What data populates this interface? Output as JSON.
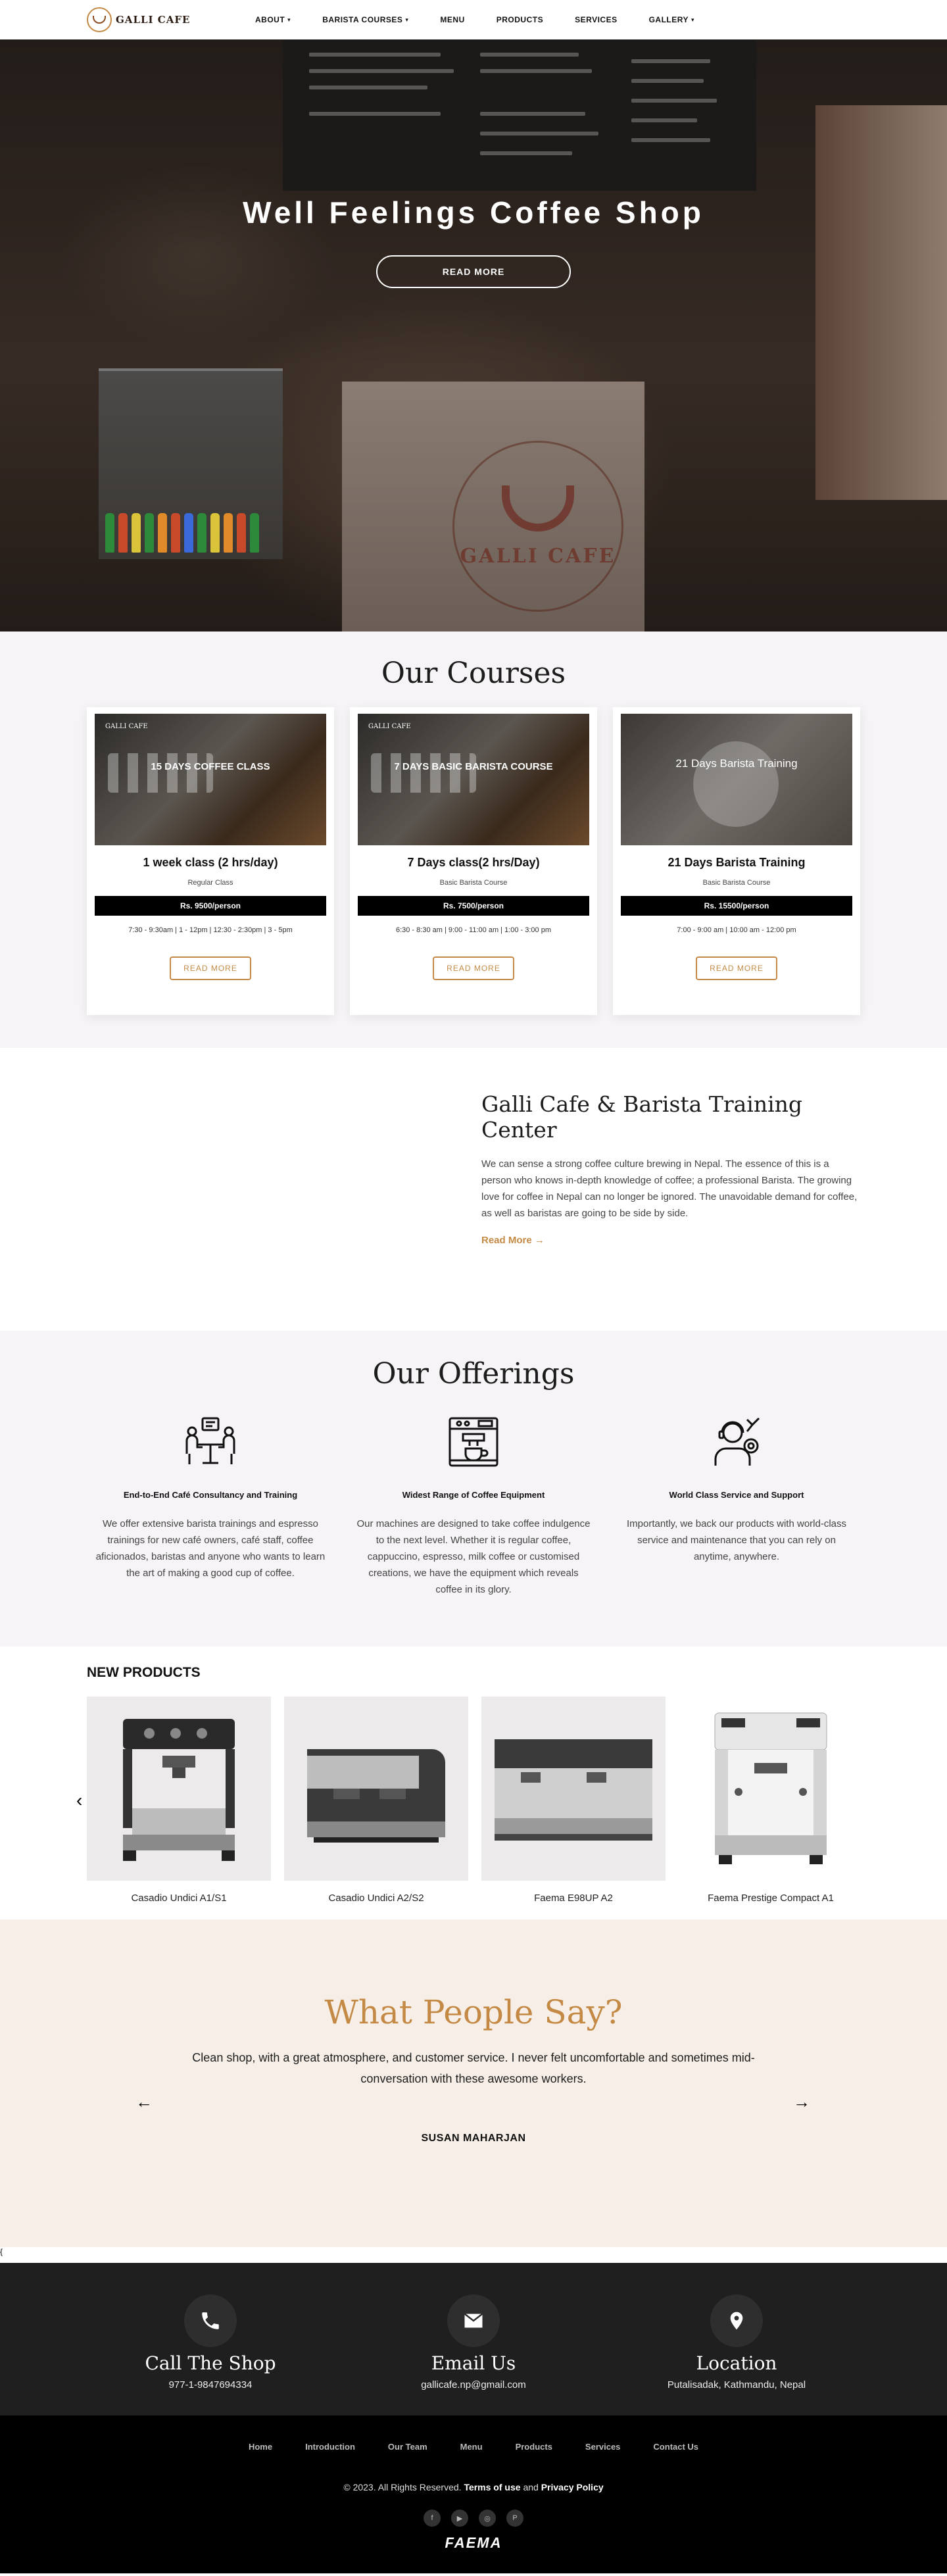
{
  "nav": {
    "logo_text": "GALLI CAFE",
    "items": [
      {
        "label": "ABOUT",
        "dropdown": true
      },
      {
        "label": "BARISTA COURSES",
        "dropdown": true
      },
      {
        "label": "MENU",
        "dropdown": false
      },
      {
        "label": "PRODUCTS",
        "dropdown": false
      },
      {
        "label": "SERVICES",
        "dropdown": false
      },
      {
        "label": "GALLERY",
        "dropdown": true
      }
    ]
  },
  "hero": {
    "title": "Well Feelings Coffee Shop",
    "button": "READ MORE",
    "sign_text": "GALLI CAFE"
  },
  "courses": {
    "title": "Our Courses",
    "items": [
      {
        "image_label": "15 DAYS COFFEE CLASS",
        "name": "1 week class (2 hrs/day)",
        "sub": "Regular Class",
        "price": "Rs. 9500/person",
        "time": "7:30 - 9:30am | 1 - 12pm | 12:30 - 2:30pm | 3 - 5pm",
        "button": "READ MORE"
      },
      {
        "image_label": "7 DAYS BASIC BARISTA COURSE",
        "name": "7 Days class(2 hrs/Day)",
        "sub": "Basic Barista Course",
        "price": "Rs. 7500/person",
        "time": "6:30 - 8:30 am | 9:00 - 11:00 am | 1:00 - 3:00 pm",
        "button": "READ MORE"
      },
      {
        "image_label": "21 Days Barista Training",
        "name": "21 Days Barista Training",
        "sub": "Basic Barista Course",
        "price": "Rs. 15500/person",
        "time": "7:00 - 9:00 am | 10:00 am - 12:00 pm",
        "button": "READ MORE"
      }
    ]
  },
  "about": {
    "title": "Galli Cafe & Barista Training Center",
    "body": "We can sense a strong coffee culture brewing in Nepal. The essence of this is a person who knows in-depth knowledge of coffee; a professional Barista. The growing love for coffee in Nepal can no longer be ignored. The unavoidable demand for coffee, as well as baristas are going to be side by side.",
    "link": "Read More →"
  },
  "offerings": {
    "title": "Our Offerings",
    "items": [
      {
        "icon": "consultancy-icon",
        "title": "End-to-End Café Consultancy and Training",
        "text": "We offer extensive barista trainings and espresso trainings for new café owners, café staff, coffee aficionados, baristas and anyone who wants to learn the art of making a good cup of coffee."
      },
      {
        "icon": "coffee-machine-icon",
        "title": "Widest Range of Coffee Equipment",
        "text": "Our machines are designed to take coffee indulgence to the next level. Whether it is regular coffee, cappuccino, espresso, milk coffee or customised creations, we have the equipment which reveals coffee in its glory."
      },
      {
        "icon": "service-person-icon",
        "title": "World Class Service and Support",
        "text": "Importantly, we back our products with world-class service and maintenance that you can rely on anytime, anywhere."
      }
    ]
  },
  "products": {
    "title": "NEW PRODUCTS",
    "items": [
      {
        "name": "Casadio Undici A1/S1"
      },
      {
        "name": "Casadio Undici A2/S2"
      },
      {
        "name": "Faema E98UP A2"
      },
      {
        "name": "Faema Prestige Compact A1"
      }
    ]
  },
  "testimonial": {
    "title": "What People Say?",
    "quote": "Clean shop, with a great atmosphere, and customer service. I never felt uncomfortable and sometimes mid-conversation with these awesome workers.",
    "author": "SUSAN MAHARJAN"
  },
  "strip": {
    "text": "{"
  },
  "contact": {
    "items": [
      {
        "icon": "phone-icon",
        "title": "Call The Shop",
        "value": "977-1-9847694334"
      },
      {
        "icon": "email-icon",
        "title": "Email Us",
        "value": "gallicafe.np@gmail.com"
      },
      {
        "icon": "location-icon",
        "title": "Location",
        "value": "Putalisadak, Kathmandu, Nepal"
      }
    ]
  },
  "footer": {
    "links": [
      "Home",
      "Introduction",
      "Our Team",
      "Menu",
      "Products",
      "Services",
      "Contact Us"
    ],
    "copyright": "© 2023. All Rights Reserved.",
    "terms": "Terms of use",
    "and": "and",
    "privacy": "Privacy Policy",
    "socials": [
      {
        "icon": "facebook-icon",
        "glyph": "f"
      },
      {
        "icon": "youtube-icon",
        "glyph": "▶"
      },
      {
        "icon": "instagram-icon",
        "glyph": "◎"
      },
      {
        "icon": "pinterest-icon",
        "glyph": "P"
      }
    ],
    "brand": "FAEMA"
  },
  "colors": {
    "accent": "#c48a45",
    "dark": "#1f1f1f",
    "testimonial_bg": "#f7efe7",
    "section_bg": "#f6f4f6"
  }
}
